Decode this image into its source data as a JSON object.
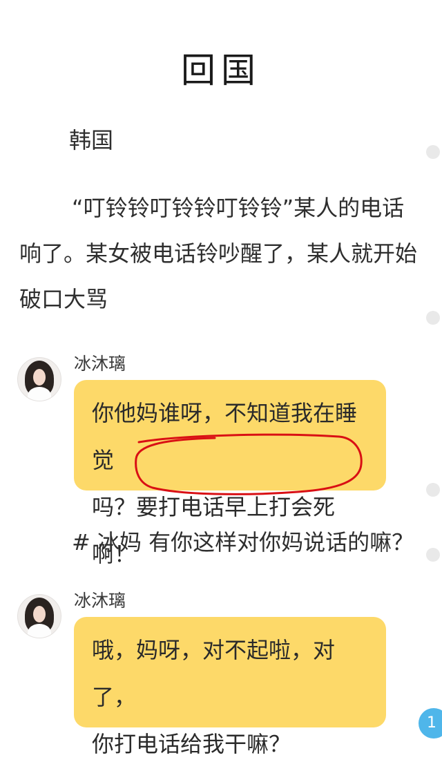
{
  "article": {
    "title": "回国",
    "paragraphs": [
      "韩国",
      "“叮铃铃叮铃铃叮铃铃”某人的电话响了。某女被电话铃吵醒了，某人就开始破口大骂",
      "# 冰妈  有你这样对你妈说话的嘛？"
    ]
  },
  "chats": [
    {
      "name": "冰沐璃",
      "avatar_icon": "girl-avatar",
      "lines": [
        "你他妈谁呀，不知道我在睡觉",
        "吗？要打电话早上打会死啊！"
      ]
    },
    {
      "name": "冰沐璃",
      "avatar_icon": "girl-avatar",
      "lines": [
        "哦，妈呀，对不起啦，对了，",
        "你打电话给我干嘛？"
      ]
    }
  ],
  "annotation": {
    "color": "#d90f14",
    "shape": "hand-drawn-circle"
  },
  "colors": {
    "bubble": "#fdd969",
    "badge": "#4fb6ea"
  },
  "badge": {
    "count": "1"
  }
}
